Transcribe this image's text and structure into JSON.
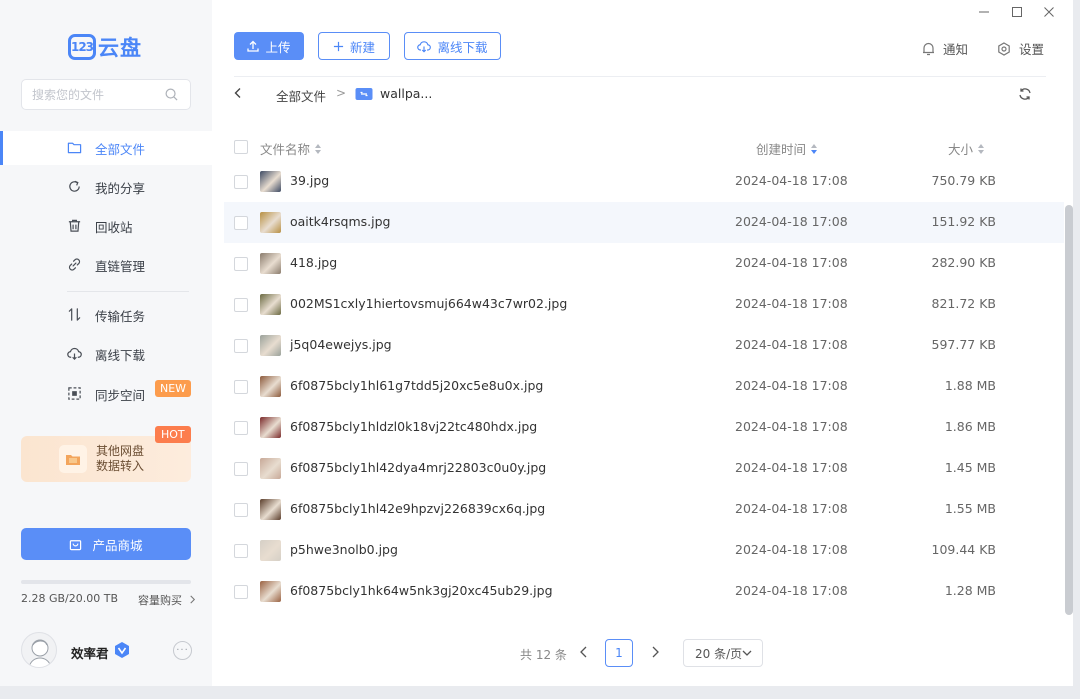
{
  "app": {
    "logo_mark": "123",
    "logo_text": "云盘",
    "brand_color": "#4b86f7"
  },
  "search": {
    "placeholder": "搜索您的文件"
  },
  "sidebar": {
    "items": [
      {
        "label": "全部文件",
        "icon": "folder-icon",
        "active": true
      },
      {
        "label": "我的分享",
        "icon": "share-icon"
      },
      {
        "label": "回收站",
        "icon": "trash-icon"
      },
      {
        "label": "直链管理",
        "icon": "link-icon"
      },
      {
        "label": "传输任务",
        "icon": "transfer-icon"
      },
      {
        "label": "离线下载",
        "icon": "cloud-download-icon"
      },
      {
        "label": "同步空间",
        "icon": "sync-icon"
      }
    ],
    "new_badge": "NEW",
    "promo": {
      "line1": "其他网盘",
      "line2": "数据转入",
      "badge": "HOT"
    },
    "mall_button": "产品商城",
    "storage": {
      "used_text": "2.28 GB/20.00 TB",
      "used_fraction": 0.0001,
      "buy_label": "容量购买"
    },
    "user": {
      "name": "效率君",
      "more": "···"
    }
  },
  "toolbar": {
    "upload": "上传",
    "new": "新建",
    "offline": "离线下载",
    "notify": "通知",
    "settings": "设置"
  },
  "breadcrumb": {
    "root": "全部文件",
    "separator": ">",
    "current": "wallpa..."
  },
  "table": {
    "headers": {
      "name": "文件名称",
      "created": "创建时间",
      "size": "大小"
    },
    "rows": [
      {
        "name": "39.jpg",
        "date": "2024-04-18 17:08",
        "size": "750.79 KB",
        "thumb": "#3d4a63"
      },
      {
        "name": "oaitk4rsqms.jpg",
        "date": "2024-04-18 17:08",
        "size": "151.92 KB",
        "thumb": "#b89043"
      },
      {
        "name": "418.jpg",
        "date": "2024-04-18 17:08",
        "size": "282.90 KB",
        "thumb": "#8a7b6c"
      },
      {
        "name": "002MS1cxly1hiertovsmuj664w43c7wr02.jpg",
        "date": "2024-04-18 17:08",
        "size": "821.72 KB",
        "thumb": "#6b6a42"
      },
      {
        "name": "j5q04ewejys.jpg",
        "date": "2024-04-18 17:08",
        "size": "597.77 KB",
        "thumb": "#9aa19a"
      },
      {
        "name": "6f0875bcly1hl61g7tdd5j20xc5e8u0x.jpg",
        "date": "2024-04-18 17:08",
        "size": "1.88 MB",
        "thumb": "#8c5a3c"
      },
      {
        "name": "6f0875bcly1hldzl0k18vj22tc480hdx.jpg",
        "date": "2024-04-18 17:08",
        "size": "1.86 MB",
        "thumb": "#7a2a2a"
      },
      {
        "name": "6f0875bcly1hl42dya4mrj22803c0u0y.jpg",
        "date": "2024-04-18 17:08",
        "size": "1.45 MB",
        "thumb": "#c7a897"
      },
      {
        "name": "6f0875bcly1hl42e9hpzvj226839cx6q.jpg",
        "date": "2024-04-18 17:08",
        "size": "1.55 MB",
        "thumb": "#5a3d2b"
      },
      {
        "name": "p5hwe3nolb0.jpg",
        "date": "2024-04-18 17:08",
        "size": "109.44 KB",
        "thumb": "#d5cfc6"
      },
      {
        "name": "6f0875bcly1hk64w5nk3gj20xc45ub29.jpg",
        "date": "2024-04-18 17:08",
        "size": "1.28 MB",
        "thumb": "#9a6242"
      }
    ]
  },
  "pagination": {
    "total": "共 12 条",
    "page": "1",
    "page_size": "20 条/页"
  }
}
